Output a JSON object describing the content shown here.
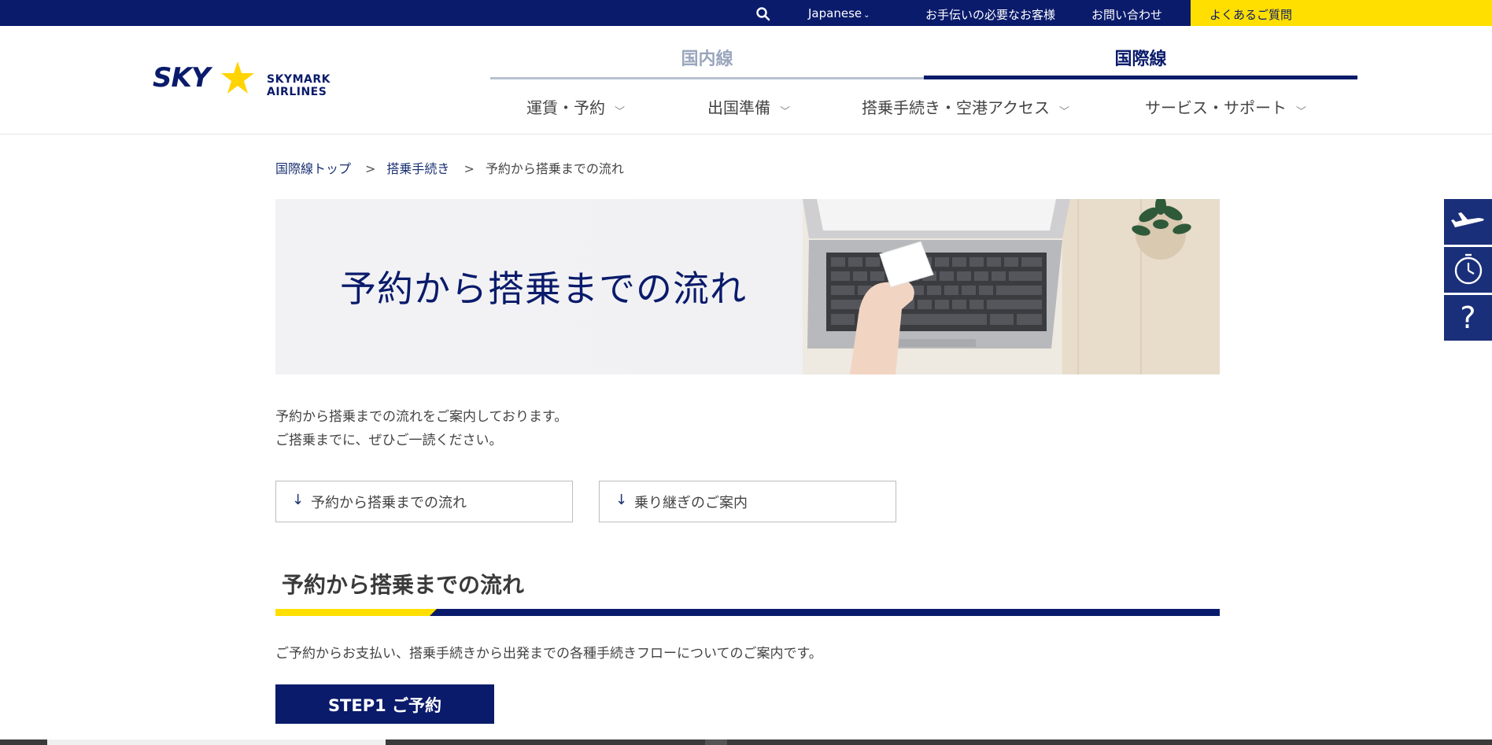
{
  "topbar": {
    "language": "Japanese",
    "help_link": "お手伝いの必要なお客様",
    "contact_link": "お問い合わせ",
    "faq_link": "よくあるご質問"
  },
  "header": {
    "logo_mark": "SKY",
    "logo_text": "SKYMARK AIRLINES",
    "tab_domestic": "国内線",
    "tab_international": "国際線",
    "nav": [
      {
        "label": "運賃・予約"
      },
      {
        "label": "出国準備"
      },
      {
        "label": "搭乗手続き・空港アクセス"
      },
      {
        "label": "サービス・サポート"
      }
    ]
  },
  "breadcrumb": {
    "items": [
      "国際線トップ",
      "搭乗手続き",
      "予約から搭乗までの流れ"
    ],
    "separator": ">"
  },
  "hero": {
    "title": "予約から搭乗までの流れ"
  },
  "intro": {
    "line1": "予約から搭乗までの流れをご案内しております。",
    "line2": "ご搭乗までに、ぜひご一読ください。"
  },
  "anchors": [
    {
      "arrow": "↓",
      "label": "予約から搭乗までの流れ"
    },
    {
      "arrow": "↓",
      "label": "乗り継ぎのご案内"
    }
  ],
  "section": {
    "title": "予約から搭乗までの流れ",
    "description": "ご予約からお支払い、搭乗手続きから出発までの各種手続きフローについてのご案内です。",
    "step_button": "STEP1 ご予約"
  },
  "side_buttons": [
    {
      "icon": "airplane-icon"
    },
    {
      "icon": "clock-icon"
    },
    {
      "icon": "question-icon"
    }
  ],
  "colors": {
    "navy": "#0a1b6b",
    "yellow": "#ffdf00",
    "side_button": "#1a2f79"
  }
}
